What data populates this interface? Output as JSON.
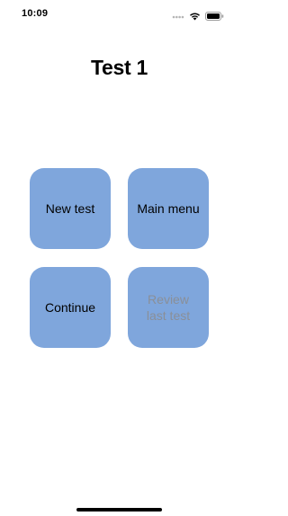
{
  "status_bar": {
    "time": "10:09",
    "icons": [
      "signal-dots-icon",
      "wifi-icon",
      "battery-icon"
    ]
  },
  "title": "Test 1",
  "tiles": {
    "new_test": "New test",
    "main_menu": "Main menu",
    "continue": "Continue",
    "review_line1": "Review",
    "review_line2": "last test"
  },
  "colors": {
    "tile_background": "#7fa6dc",
    "tile_text": "#000000",
    "disabled_text": "#8a8f98",
    "home_indicator": "#000000"
  }
}
